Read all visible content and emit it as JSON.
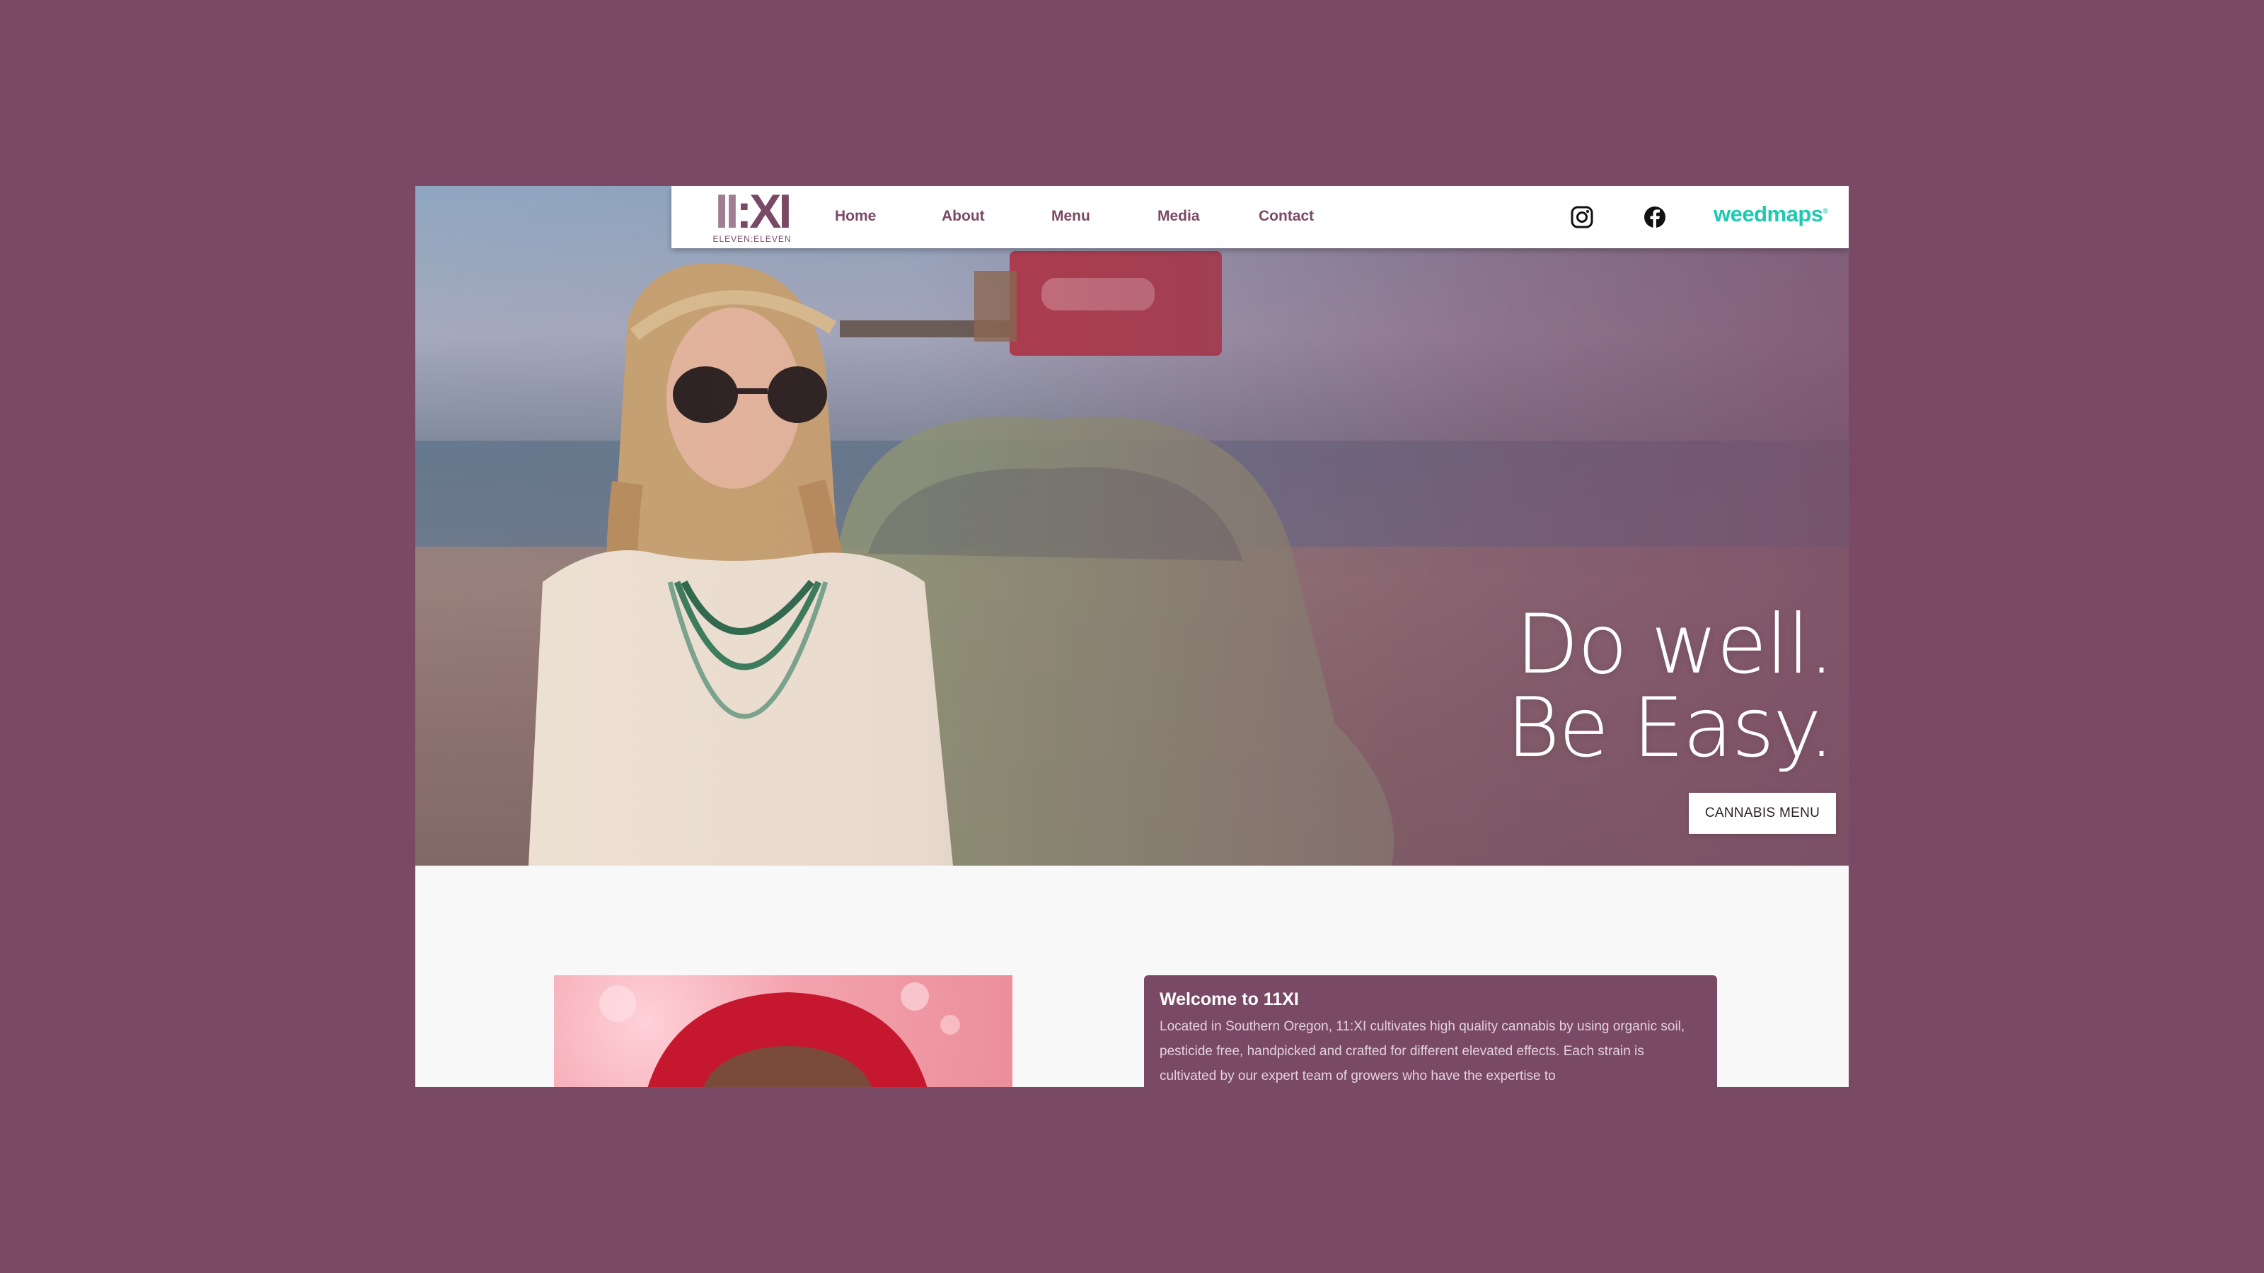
{
  "nav": {
    "logo": {
      "mark_left": "II",
      "mark_colon": ":",
      "mark_right": "XI",
      "subtext": "ELEVEN:ELEVEN"
    },
    "links": [
      {
        "label": "Home"
      },
      {
        "label": "About"
      },
      {
        "label": "Menu"
      },
      {
        "label": "Media"
      },
      {
        "label": "Contact"
      }
    ],
    "social": {
      "instagram_icon": "instagram-icon",
      "facebook_icon": "facebook-icon"
    },
    "weedmaps_label": "weedmaps"
  },
  "hero": {
    "headline_line1": "Do well.",
    "headline_line2": "Be Easy.",
    "cta_label": "CANNABIS MENU"
  },
  "about": {
    "title": "Welcome to 11XI",
    "body": "Located in Southern Oregon, 11:XI cultivates high quality cannabis by using organic soil, pesticide free, handpicked and crafted for different elevated effects. Each strain is cultivated by our expert team of growers who have the expertise to"
  },
  "colors": {
    "page_background": "#7a4965",
    "brand": "#7a4965",
    "weedmaps": "#1fc8b0",
    "card_background": "#7a4965"
  }
}
